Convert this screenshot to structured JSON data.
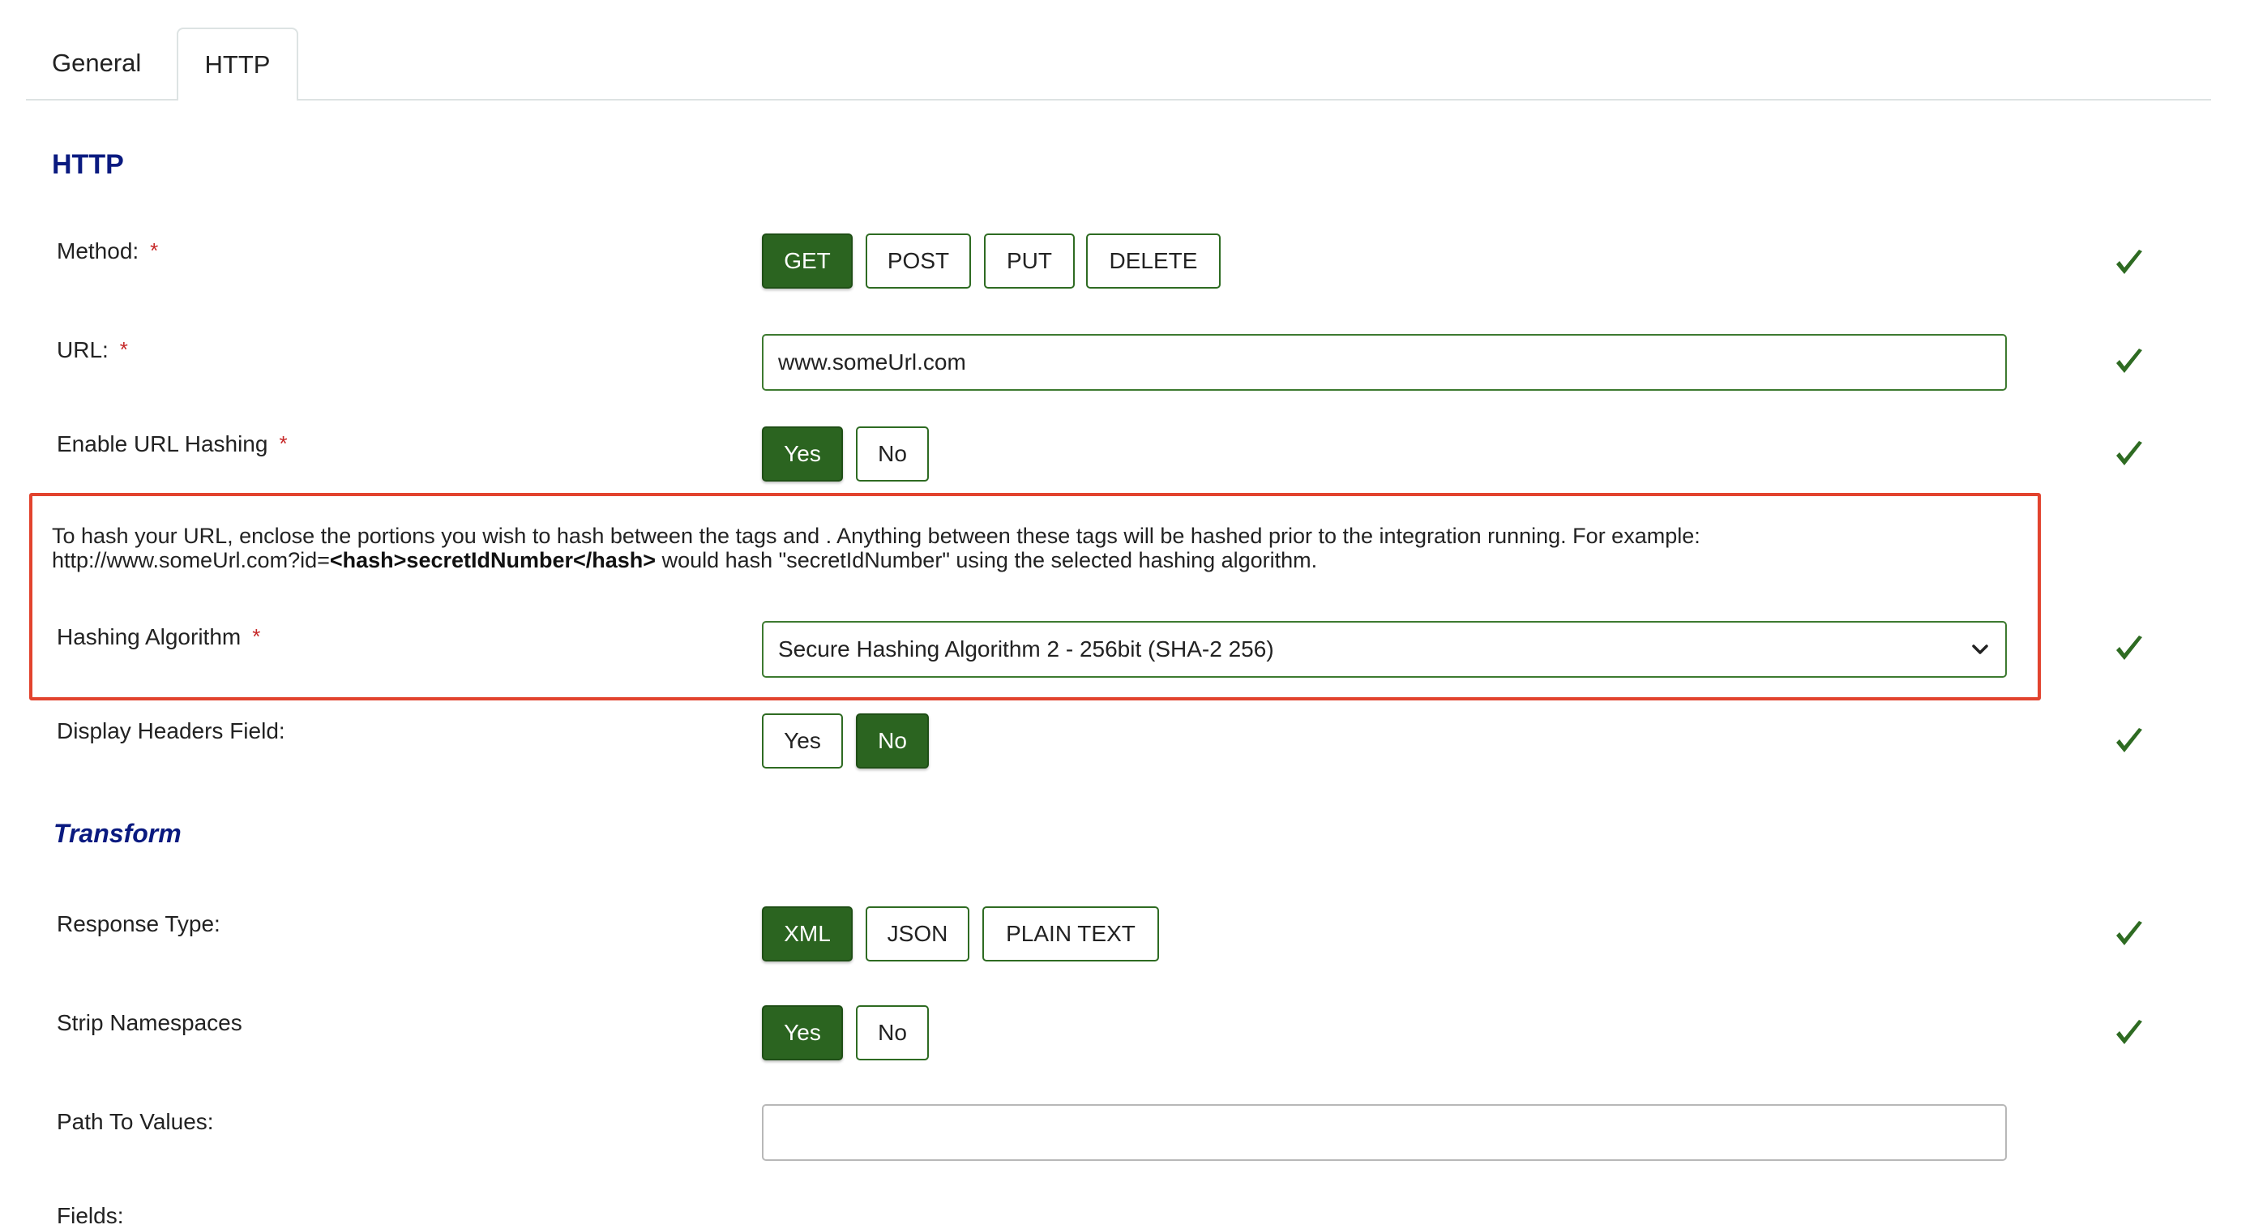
{
  "tabs": [
    {
      "label": "General"
    },
    {
      "label": "HTTP"
    }
  ],
  "sections": {
    "http_heading": "HTTP",
    "transform_heading": "Transform"
  },
  "form": {
    "method": {
      "label": "Method:",
      "required_mark": "*",
      "options": [
        "GET",
        "POST",
        "PUT",
        "DELETE"
      ],
      "selected": "GET"
    },
    "url": {
      "label": "URL:",
      "required_mark": "*",
      "value": "www.someUrl.com"
    },
    "enable_url_hashing": {
      "label": "Enable URL Hashing",
      "required_mark": "*",
      "options": [
        "Yes",
        "No"
      ],
      "selected": "Yes"
    },
    "hash_info": {
      "line1": "To hash your URL, enclose the portions you wish to hash between the tags and .  Anything between these tags will be hashed prior to the integration running.  For example:",
      "example_prefix": "http://www.someUrl.com?id=",
      "example_bold": "<hash>secretIdNumber</hash>",
      "example_suffix": " would hash \"secretIdNumber\" using the selected hashing algorithm."
    },
    "hashing_algorithm": {
      "label": "Hashing Algorithm",
      "required_mark": "*",
      "value": "Secure Hashing Algorithm 2 - 256bit (SHA-2 256)"
    },
    "display_headers": {
      "label": "Display Headers Field:",
      "options": [
        "Yes",
        "No"
      ],
      "selected": "No"
    },
    "response_type": {
      "label": "Response Type:",
      "options": [
        "XML",
        "JSON",
        "PLAIN TEXT"
      ],
      "selected": "XML"
    },
    "strip_namespaces": {
      "label": "Strip Namespaces",
      "options": [
        "Yes",
        "No"
      ],
      "selected": "Yes"
    },
    "path_to_values": {
      "label": "Path To Values:",
      "value": ""
    },
    "fields": {
      "label": "Fields:"
    }
  },
  "colors": {
    "selected_button": "#2b6420",
    "heading": "#0a1a80",
    "required": "#c62828",
    "check": "#2e6b22",
    "highlight": "#e2432e"
  },
  "icons": {
    "valid": "check-icon",
    "select": "chevron-down-icon"
  }
}
